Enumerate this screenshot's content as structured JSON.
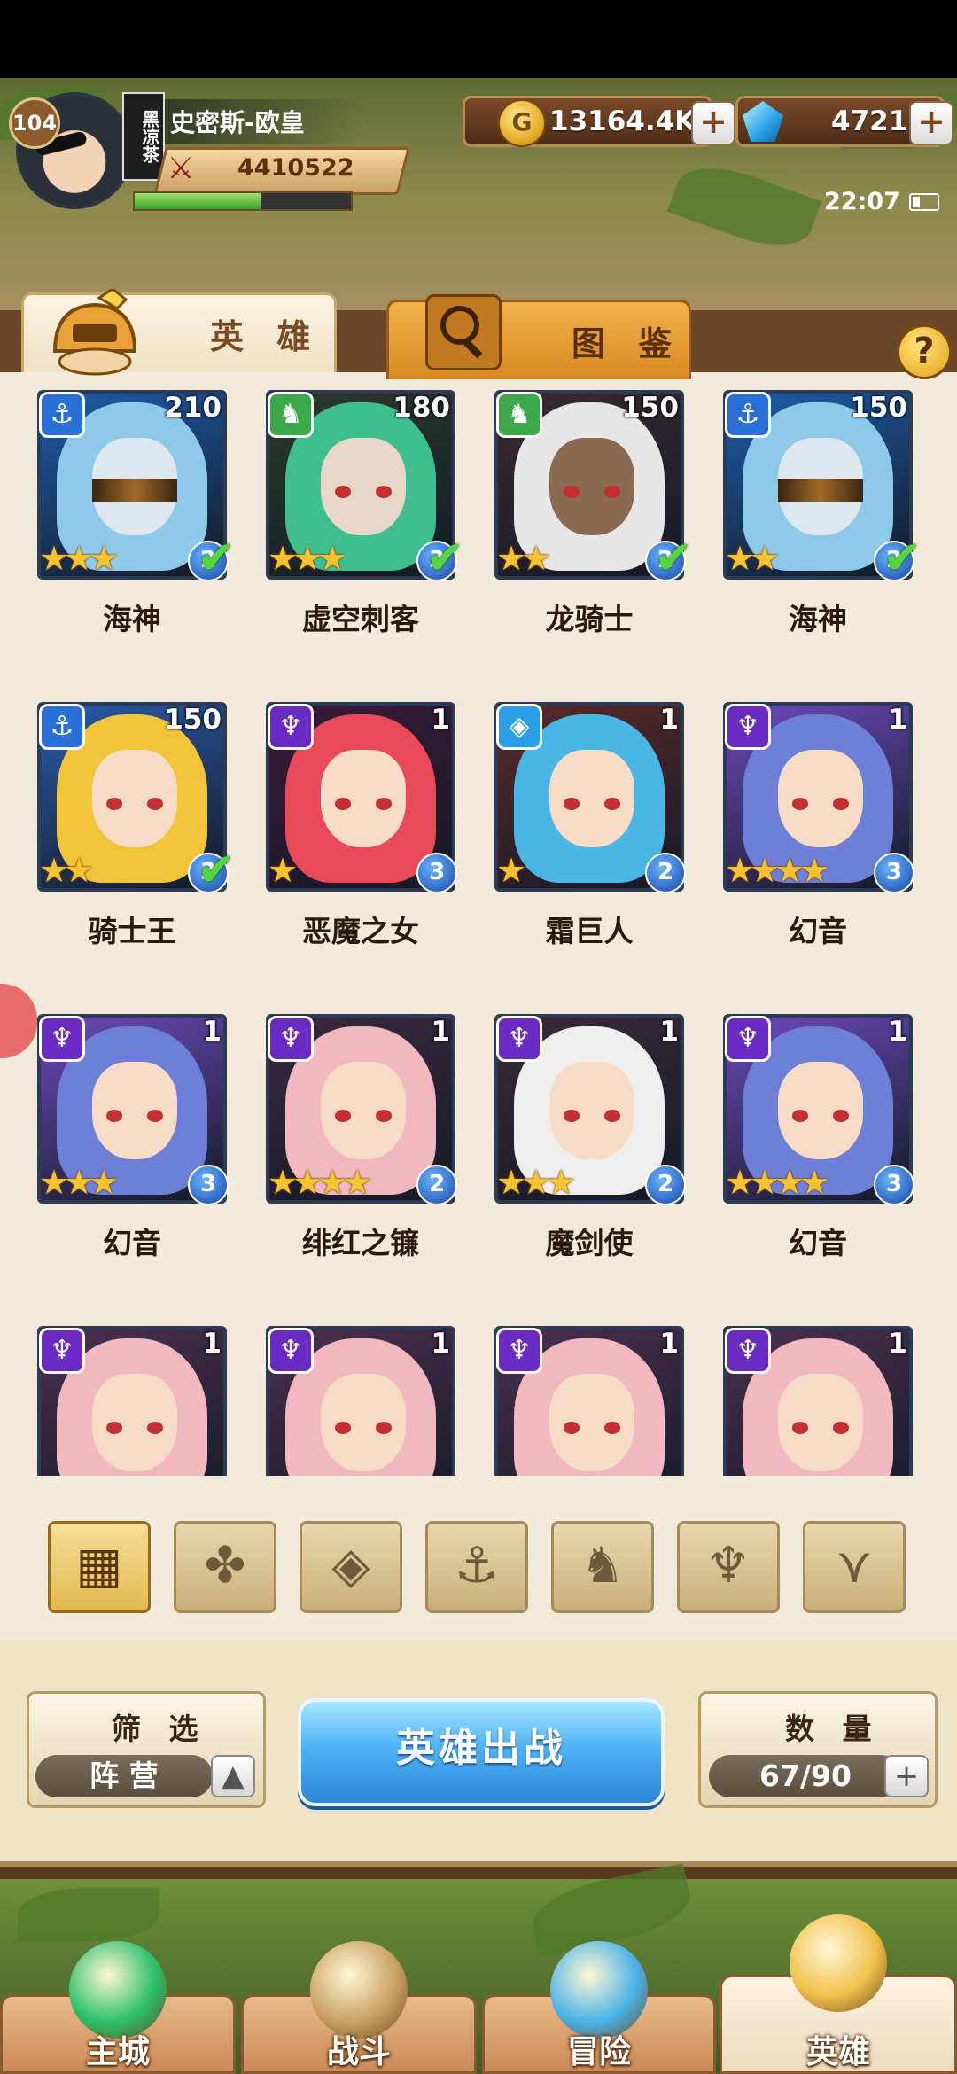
{
  "header": {
    "player_name": "史密斯-欧皇",
    "player_level": "104",
    "title_stamp": "黑凉茶",
    "power": "4410522",
    "xp_progress": 0.58,
    "gold": "13164.4K",
    "diamonds": "4721",
    "time": "22:07"
  },
  "tabs": [
    {
      "label": "英 雄",
      "active": true
    },
    {
      "label": "图 鉴",
      "active": false
    }
  ],
  "help_glyph": "?",
  "heroes": [
    {
      "name": "海神",
      "level": "210",
      "faction": "anchor-icon",
      "stars": 3,
      "rank": "2",
      "checked": true
    },
    {
      "name": "虚空刺客",
      "level": "180",
      "faction": "beast-icon",
      "stars": 3,
      "rank": "3",
      "checked": true
    },
    {
      "name": "龙骑士",
      "level": "150",
      "faction": "beast-icon",
      "stars": 2,
      "rank": "2",
      "checked": true
    },
    {
      "name": "海神",
      "level": "150",
      "faction": "anchor-icon",
      "stars": 2,
      "rank": "2",
      "checked": true
    },
    {
      "name": "骑士王",
      "level": "150",
      "faction": "anchor-icon",
      "stars": 2,
      "rank": "3",
      "checked": true
    },
    {
      "name": "恶魔之女",
      "level": "1",
      "faction": "demon-icon",
      "stars": 1,
      "rank": "3",
      "checked": false
    },
    {
      "name": "霜巨人",
      "level": "1",
      "faction": "frost-icon",
      "stars": 1,
      "rank": "2",
      "checked": false
    },
    {
      "name": "幻音",
      "level": "1",
      "faction": "demon-icon",
      "stars": 4,
      "rank": "3",
      "checked": false
    },
    {
      "name": "幻音",
      "level": "1",
      "faction": "demon-icon",
      "stars": 3,
      "rank": "3",
      "checked": false
    },
    {
      "name": "绯红之镰",
      "level": "1",
      "faction": "demon-icon",
      "stars": 4,
      "rank": "2",
      "checked": false
    },
    {
      "name": "魔剑使",
      "level": "1",
      "faction": "demon-icon",
      "stars": 3,
      "rank": "2",
      "checked": false
    },
    {
      "name": "幻音",
      "level": "1",
      "faction": "demon-icon",
      "stars": 4,
      "rank": "3",
      "checked": false
    },
    {
      "name": "",
      "level": "1",
      "faction": "demon-icon",
      "stars": 0,
      "rank": "",
      "checked": false
    },
    {
      "name": "",
      "level": "1",
      "faction": "demon-icon",
      "stars": 0,
      "rank": "",
      "checked": false
    },
    {
      "name": "",
      "level": "1",
      "faction": "demon-icon",
      "stars": 0,
      "rank": "",
      "checked": false
    },
    {
      "name": "",
      "level": "1",
      "faction": "demon-icon",
      "stars": 0,
      "rank": "",
      "checked": false
    }
  ],
  "filters": [
    {
      "icon": "grid-icon",
      "active": true
    },
    {
      "icon": "leaf-icon",
      "active": false
    },
    {
      "icon": "diamond-icon",
      "active": false
    },
    {
      "icon": "anchor-icon",
      "active": false
    },
    {
      "icon": "beast-icon",
      "active": false
    },
    {
      "icon": "horns-icon",
      "active": false
    },
    {
      "icon": "wings-icon",
      "active": false
    }
  ],
  "controls": {
    "filter_title": "筛 选",
    "filter_value": "阵 营",
    "deploy_button": "英雄出战",
    "count_title": "数 量",
    "count_value": "67/90"
  },
  "nav": [
    {
      "label": "主城",
      "active": false
    },
    {
      "label": "战斗",
      "active": false
    },
    {
      "label": "冒险",
      "active": false
    },
    {
      "label": "英雄",
      "active": true
    }
  ],
  "colors": {
    "anchor": "#2a6fd6",
    "beast": "#3da84a",
    "demon": "#6a2bc4",
    "frost": "#2a9ee6",
    "star": "#f8c330"
  }
}
